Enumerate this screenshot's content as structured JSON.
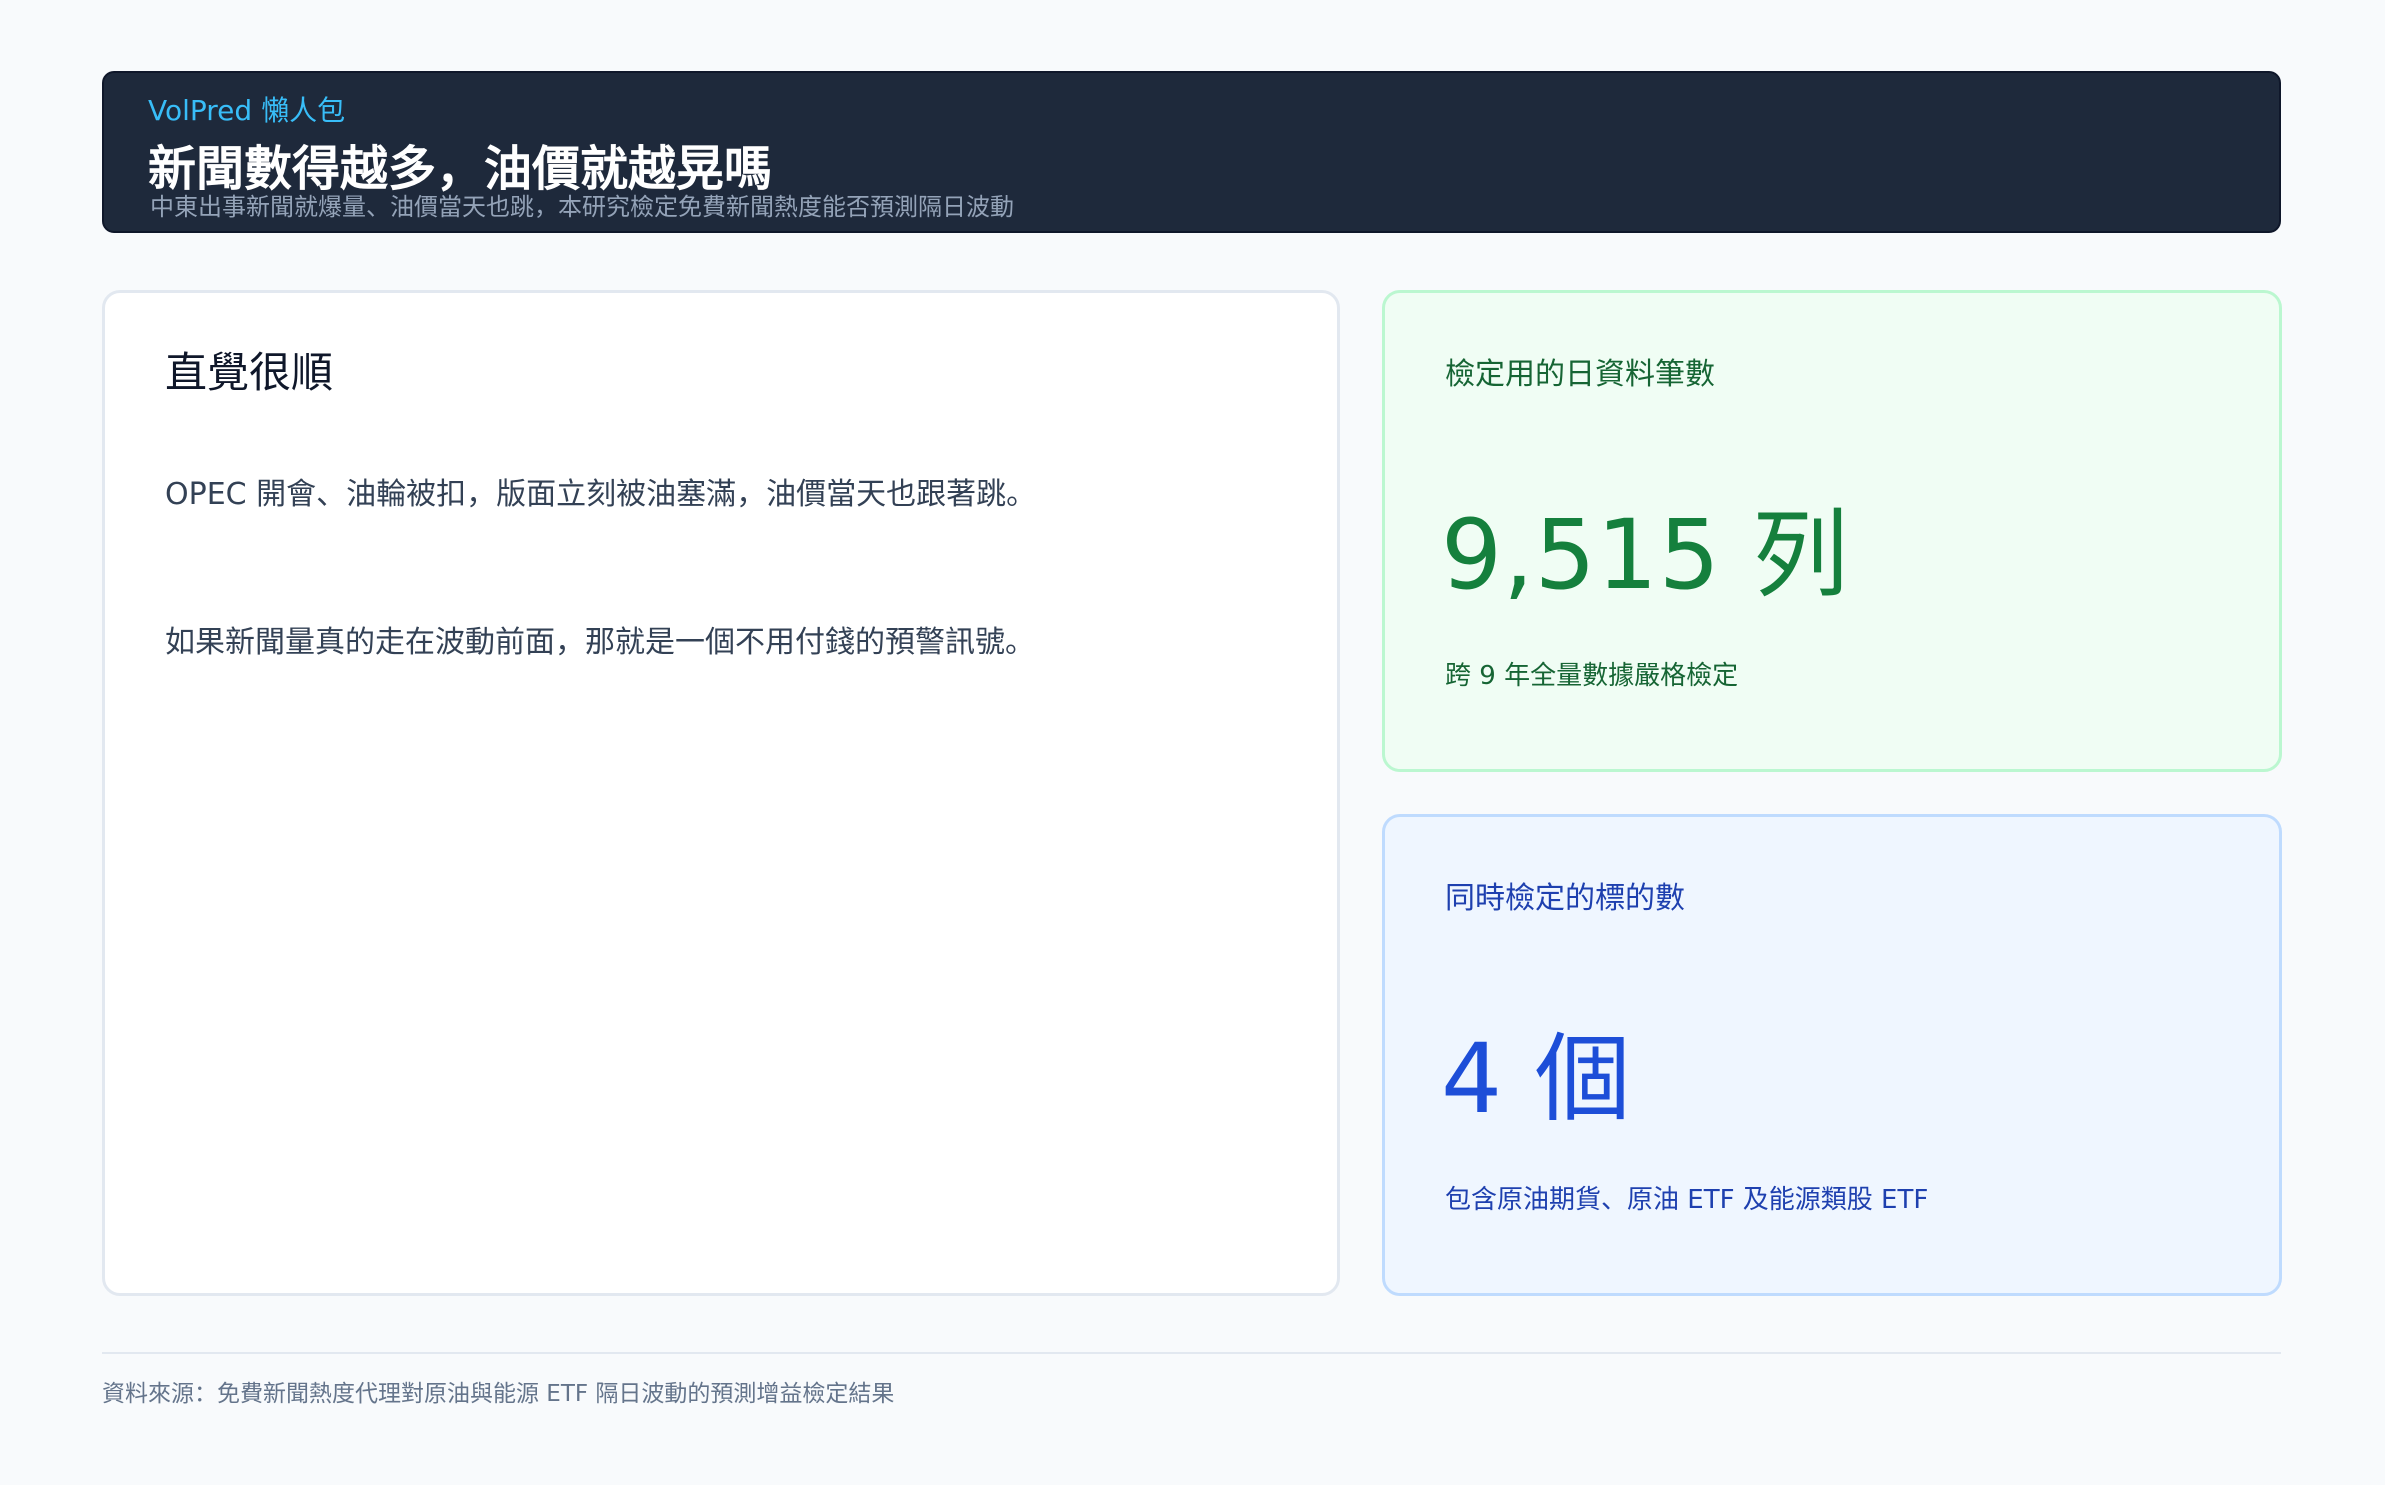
{
  "header": {
    "eyebrow": "VolPred 懶人包",
    "title": "新聞數得越多，油價就越晃嗎",
    "subtitle": "中東出事新聞就爆量、油價當天也跳，本研究檢定免費新聞熱度能否預測隔日波動"
  },
  "main_card": {
    "heading": "直覺很順",
    "paragraph_1": "OPEC 開會、油輪被扣，版面立刻被油塞滿，油價當天也跟著跳。",
    "paragraph_2": "如果新聞量真的走在波動前面，那就是一個不用付錢的預警訊號。"
  },
  "stat_rows": {
    "label": "檢定用的日資料筆數",
    "value": "9,515 列",
    "note": "跨 9 年全量數據嚴格檢定"
  },
  "stat_targets": {
    "label": "同時檢定的標的數",
    "value": "4 個",
    "note": "包含原油期貨、原油 ETF 及能源類股 ETF"
  },
  "footer": {
    "source": "資料來源：免費新聞熱度代理對原油與能源 ETF 隔日波動的預測增益檢定結果"
  },
  "colors": {
    "header_bg": "#1e293b",
    "accent": "#38bdf8",
    "green": "#15803d",
    "blue": "#1d4ed8"
  }
}
